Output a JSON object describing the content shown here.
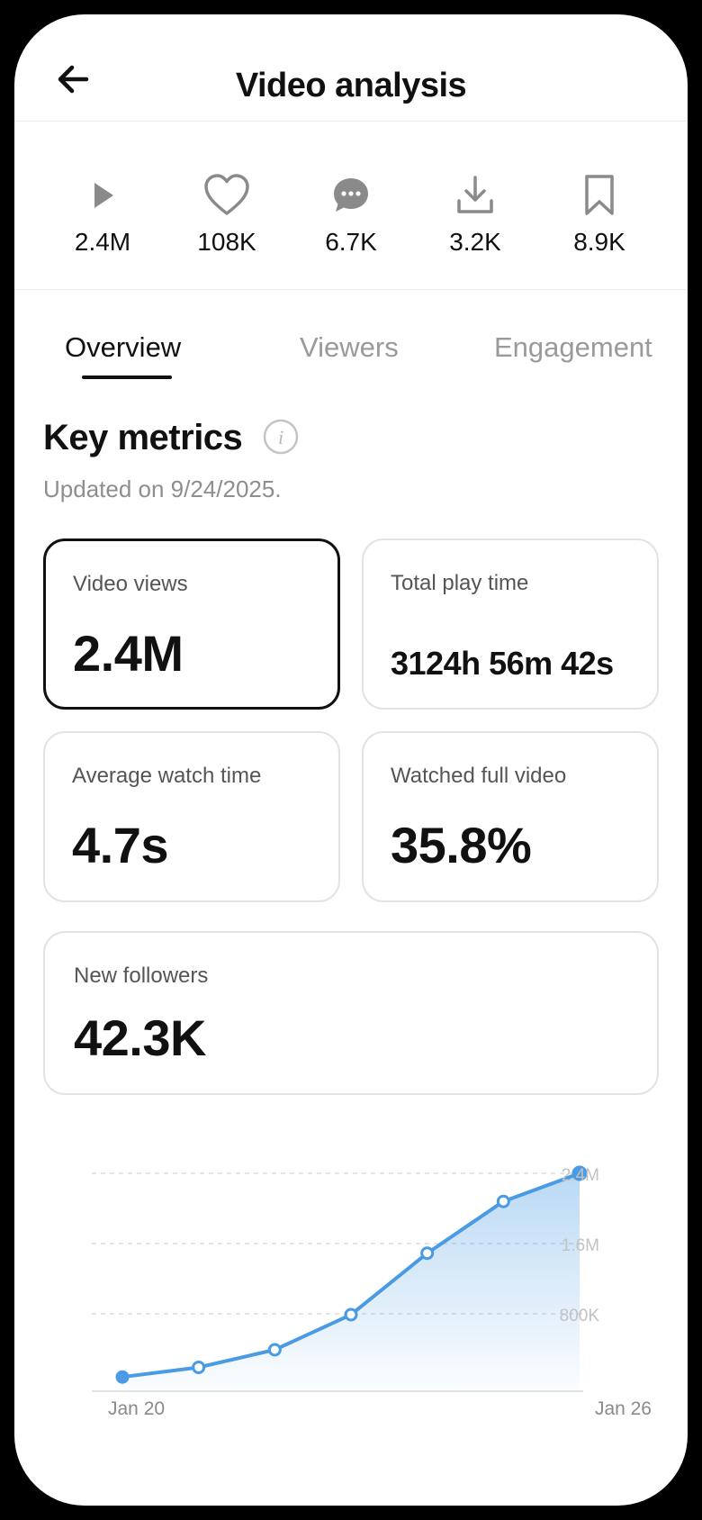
{
  "header": {
    "title": "Video analysis",
    "back_icon": "arrow-left-icon"
  },
  "stats": [
    {
      "icon": "play-icon",
      "value": "2.4M"
    },
    {
      "icon": "heart-icon",
      "value": "108K"
    },
    {
      "icon": "comment-icon",
      "value": "6.7K"
    },
    {
      "icon": "download-icon",
      "value": "3.2K"
    },
    {
      "icon": "bookmark-icon",
      "value": "8.9K"
    }
  ],
  "tabs": [
    {
      "label": "Overview",
      "active": true
    },
    {
      "label": "Viewers",
      "active": false
    },
    {
      "label": "Engagement",
      "active": false
    }
  ],
  "metrics": {
    "title": "Key metrics",
    "updated": "Updated on 9/24/2025.",
    "cards": [
      {
        "label": "Video views",
        "value": "2.4M",
        "selected": true
      },
      {
        "label": "Total play time",
        "value": "3124h 56m 42s",
        "selected": false
      },
      {
        "label": "Average watch time",
        "value": "4.7s",
        "selected": false
      },
      {
        "label": "Watched full video",
        "value": "35.8%",
        "selected": false
      },
      {
        "label": "New followers",
        "value": "42.3K",
        "selected": false
      }
    ]
  },
  "chart_data": {
    "type": "area",
    "x_labels": [
      "Jan 20",
      "Jan 26"
    ],
    "y_ticks": [
      "2.4M",
      "1.6M",
      "800K"
    ],
    "values": [
      80000,
      190000,
      390000,
      790000,
      1490000,
      2080000,
      2400000
    ],
    "ylim": [
      0,
      2400000
    ],
    "color": "#4a9be3",
    "grid": true
  }
}
